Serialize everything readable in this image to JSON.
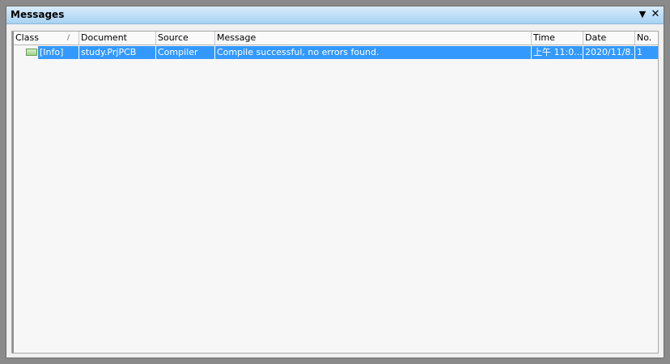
{
  "panel": {
    "title": "Messages"
  },
  "icons": {
    "menu": "dropdown-triangle-icon",
    "close": "close-icon",
    "info": "info-message-icon"
  },
  "columns": [
    "Class",
    "Document",
    "Source",
    "Message",
    "Time",
    "Date",
    "No."
  ],
  "sort": {
    "column": "Class",
    "indicator": "/"
  },
  "rows": [
    {
      "class": "[Info]",
      "document": "study.PrjPCB",
      "source": "Compiler",
      "message": "Compile successful, no errors found.",
      "time": "上午 11:0...",
      "date": "2020/11/8...",
      "no": "1"
    }
  ],
  "colors": {
    "selection": "#3399ff",
    "titlebar": "#a7d2f3"
  }
}
